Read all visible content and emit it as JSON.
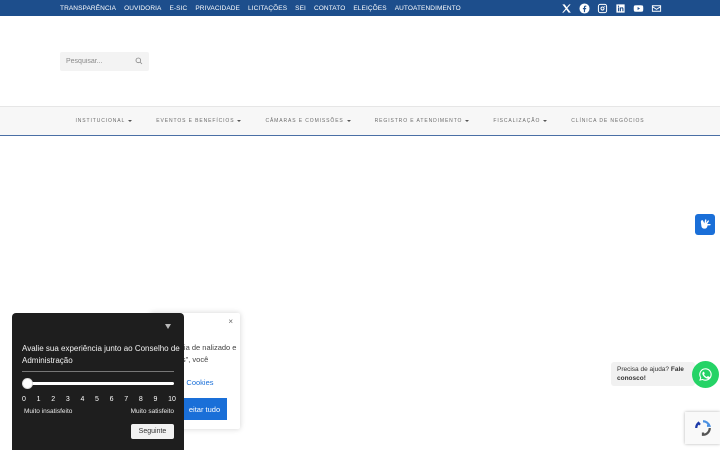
{
  "topbar": {
    "links": [
      "TRANSPARÊNCIA",
      "OUVIDORIA",
      "E-SIC",
      "PRIVACIDADE",
      "LICITAÇÕES",
      "SEI",
      "CONTATO",
      "ELEIÇÕES",
      "AUTOATENDIMENTO"
    ],
    "social_icons": [
      "x-icon",
      "facebook-icon",
      "instagram-icon",
      "linkedin-icon",
      "youtube-icon",
      "email-icon"
    ]
  },
  "search": {
    "placeholder": "Pesquisar..."
  },
  "nav": {
    "items": [
      {
        "label": "INSTITUCIONAL",
        "dropdown": true
      },
      {
        "label": "EVENTOS E BENEFÍCIOS",
        "dropdown": true
      },
      {
        "label": "CÂMARAS E COMISSÕES",
        "dropdown": true
      },
      {
        "label": "REGISTRO E ATENDIMENTO",
        "dropdown": true
      },
      {
        "label": "FISCALIZAÇÃO",
        "dropdown": true
      },
      {
        "label": "CLÍNICA DE NEGÓCIOS",
        "dropdown": false
      }
    ]
  },
  "cookie": {
    "close": "×",
    "text": "ncia de nalizado e los\", você",
    "link": "de Cookies",
    "accept": "eitar tudo"
  },
  "survey": {
    "question": "Avalie sua experiência junto ao Conselho de Administração",
    "scale": [
      "0",
      "1",
      "2",
      "3",
      "4",
      "5",
      "6",
      "7",
      "8",
      "9",
      "10"
    ],
    "selected_value": 0,
    "low_label": "Muito insatisfeito",
    "high_label": "Muito satisfeito",
    "next_label": "Seguinte"
  },
  "help": {
    "text": "Precisa de ajuda?",
    "cta": "Fale conosco!"
  },
  "colors": {
    "topbar": "#1d4e8c",
    "accent": "#1a6fd8",
    "whatsapp": "#25d366",
    "survey_bg": "#1e1e1e"
  }
}
